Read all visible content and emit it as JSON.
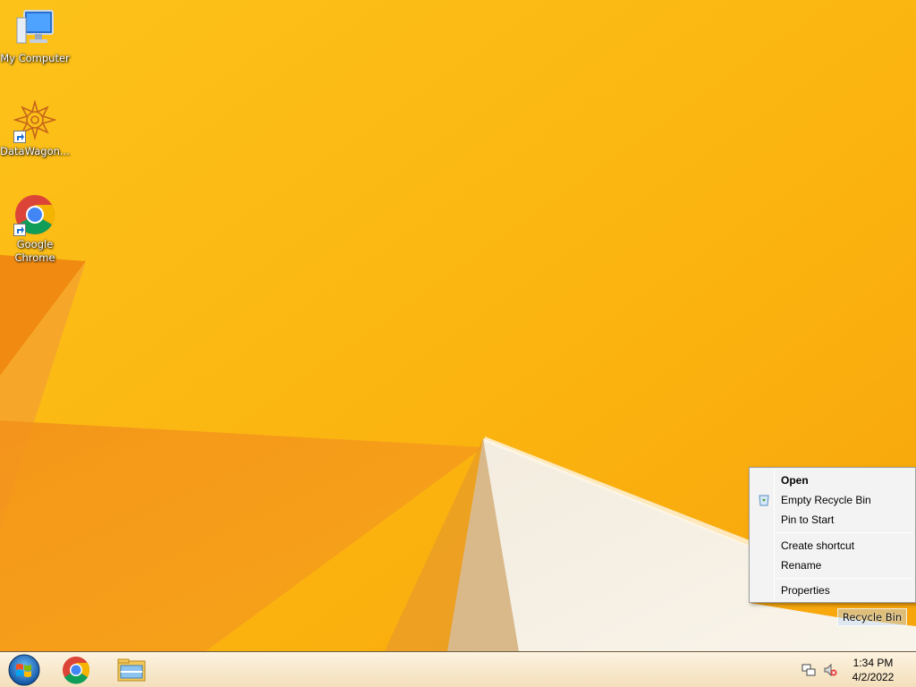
{
  "desktop": {
    "icons": [
      {
        "label": "My Computer"
      },
      {
        "label": "DataWagon..."
      },
      {
        "label": "Google Chrome"
      }
    ],
    "recycle_bin": {
      "label": "Recycle Bin"
    }
  },
  "context_menu": {
    "items": [
      {
        "label": "Open",
        "bold": true
      },
      {
        "label": "Empty Recycle Bin",
        "icon": "recycle-bin-icon"
      },
      {
        "label": "Pin to Start"
      },
      {
        "label": "Create shortcut"
      },
      {
        "label": "Rename"
      },
      {
        "label": "Properties"
      }
    ]
  },
  "taskbar": {
    "pinned": [
      {
        "name": "start-button"
      },
      {
        "name": "chrome-taskbar-button"
      },
      {
        "name": "file-explorer-taskbar-button"
      }
    ],
    "tray": {
      "icons": [
        "network-icon",
        "volume-muted-icon"
      ],
      "time": "1:34 PM",
      "date": "4/2/2022"
    }
  },
  "colors": {
    "wallpaper": "#fbb811",
    "wallpaper_orange": "#f08a10",
    "taskbar": "#f7e7c8",
    "menu_bg": "#f3f3f3"
  }
}
